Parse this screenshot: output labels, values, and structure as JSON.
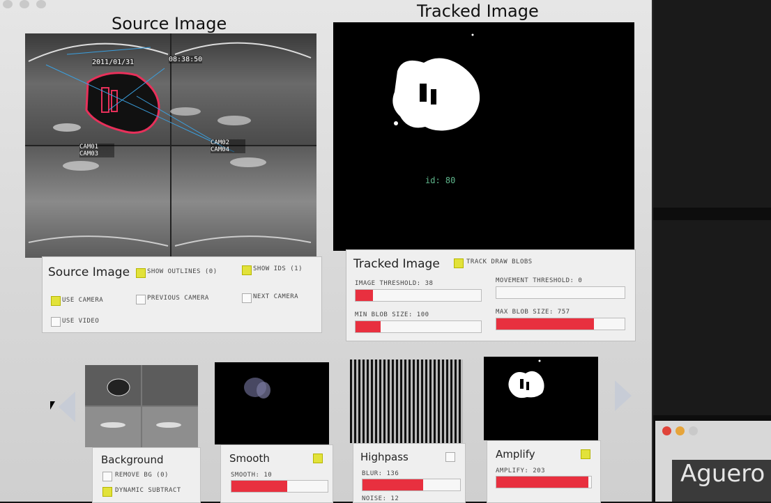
{
  "colors": {
    "accent": "#e8303f",
    "checkbox_on": "#e2e23a",
    "panel": "#efefef"
  },
  "source_title": "Source Image",
  "tracked_title": "Tracked Image",
  "source_overlay": {
    "date_label": "2011/01/31",
    "time_label": "08:38:50",
    "cam_labels": [
      "CAM01 CAM03",
      "CAM02 CAM04"
    ]
  },
  "tracked_overlay": {
    "id_label": "id: 80"
  },
  "source_panel": {
    "title": "Source Image",
    "show_outlines": "SHOW OUTLINES (0)",
    "show_ids": "SHOW IDS (1)",
    "use_camera": "USE CAMERA",
    "previous_camera": "PREVIOUS CAMERA",
    "next_camera": "NEXT CAMERA",
    "use_video": "USE VIDEO",
    "checked": {
      "show_outlines": true,
      "show_ids": true,
      "use_camera": true,
      "previous_camera": false,
      "next_camera": false,
      "use_video": false
    }
  },
  "tracked_panel": {
    "title": "Tracked Image",
    "track_draw_blobs": "TRACK DRAW BLOBS",
    "track_draw_blobs_checked": true,
    "sliders": [
      {
        "label": "IMAGE THRESHOLD: 38",
        "fraction": 0.14
      },
      {
        "label": "MOVEMENT THRESHOLD: 0",
        "fraction": 0.0
      },
      {
        "label": "MIN BLOB SIZE: 100",
        "fraction": 0.2
      },
      {
        "label": "MAX BLOB SIZE: 757",
        "fraction": 0.76
      }
    ]
  },
  "filters": [
    {
      "name": "Background",
      "options": [
        "REMOVE BG (0)",
        "DYNAMIC SUBTRACT"
      ],
      "checked": [
        false,
        true
      ]
    },
    {
      "name": "Smooth",
      "enabled": true,
      "slider_label": "SMOOTH: 10",
      "fraction": 0.58
    },
    {
      "name": "Highpass",
      "enabled": false,
      "slider_label": "BLUR: 136",
      "fraction": 0.62,
      "extra_label": "NOISE: 12"
    },
    {
      "name": "Amplify",
      "enabled": true,
      "slider_label": "AMPLIFY: 203",
      "fraction": 0.97
    }
  ],
  "background_window": {
    "text": "Aguero"
  }
}
